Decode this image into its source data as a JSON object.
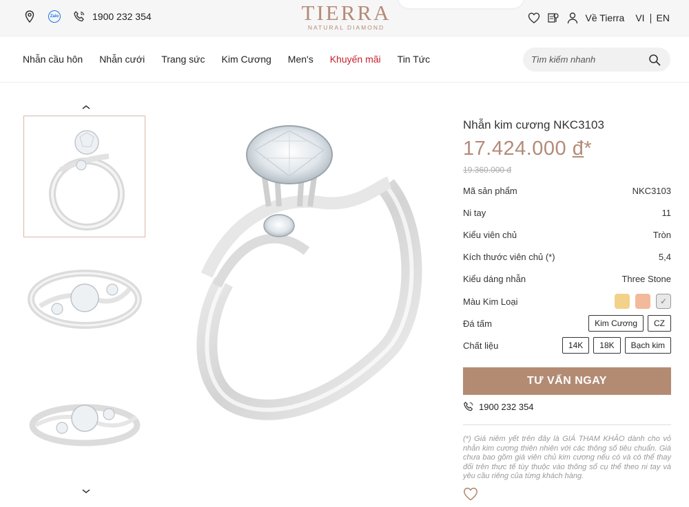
{
  "topbar": {
    "hotline": "1900 232 354",
    "zalo_label": "Zalo",
    "about": "Về Tierra",
    "lang_vi": "VI",
    "lang_en": "EN"
  },
  "logo": {
    "main": "TIERRA",
    "sub": "NATURAL DIAMOND"
  },
  "nav": {
    "items": [
      "Nhẫn cầu hôn",
      "Nhẫn cưới",
      "Trang sức",
      "Kim Cương",
      "Men's",
      "Khuyến mãi",
      "Tin Tức"
    ]
  },
  "search": {
    "placeholder": "Tìm kiếm nhanh"
  },
  "product": {
    "title": "Nhẫn kim cương NKC3103",
    "price": "17.424.000",
    "currency": "đ",
    "price_mark": "*",
    "old_price": "19.360.000 đ",
    "specs": [
      {
        "label": "Mã sản phẩm",
        "value": "NKC3103"
      },
      {
        "label": "Ni tay",
        "value": "11"
      },
      {
        "label": "Kiểu viên chủ",
        "value": "Tròn"
      },
      {
        "label": "Kích thước viên chủ (*)",
        "value": "5,4"
      },
      {
        "label": "Kiểu dáng nhẫn",
        "value": "Three Stone"
      }
    ],
    "metal_label": "Màu Kim Loại",
    "metal_colors": {
      "gold": "#f2d28a",
      "rose": "#f2b99a",
      "white": "#e8e8e8"
    },
    "side_stone_label": "Đá tấm",
    "side_stone_options": [
      "Kim Cương",
      "CZ"
    ],
    "material_label": "Chất liệu",
    "material_options": [
      "14K",
      "18K",
      "Bạch kim"
    ],
    "cta": "TƯ VẤN NGAY",
    "phone": "1900 232 354",
    "note": "(*) Giá niêm yết trên đây là GIÁ THAM KHẢO dành cho vỏ nhẫn kim cương thiên nhiên với các thông số tiêu chuẩn. Giá chưa bao gồm giá viên chủ kim cương nếu có và có thể thay đổi trên thực tế tùy thuộc vào thông số cụ thể theo ni tay và yêu cầu riêng của từng khách hàng."
  },
  "colors": {
    "accent": "#b38b73",
    "promo": "#c81e2a",
    "logo": "#b48a78"
  }
}
